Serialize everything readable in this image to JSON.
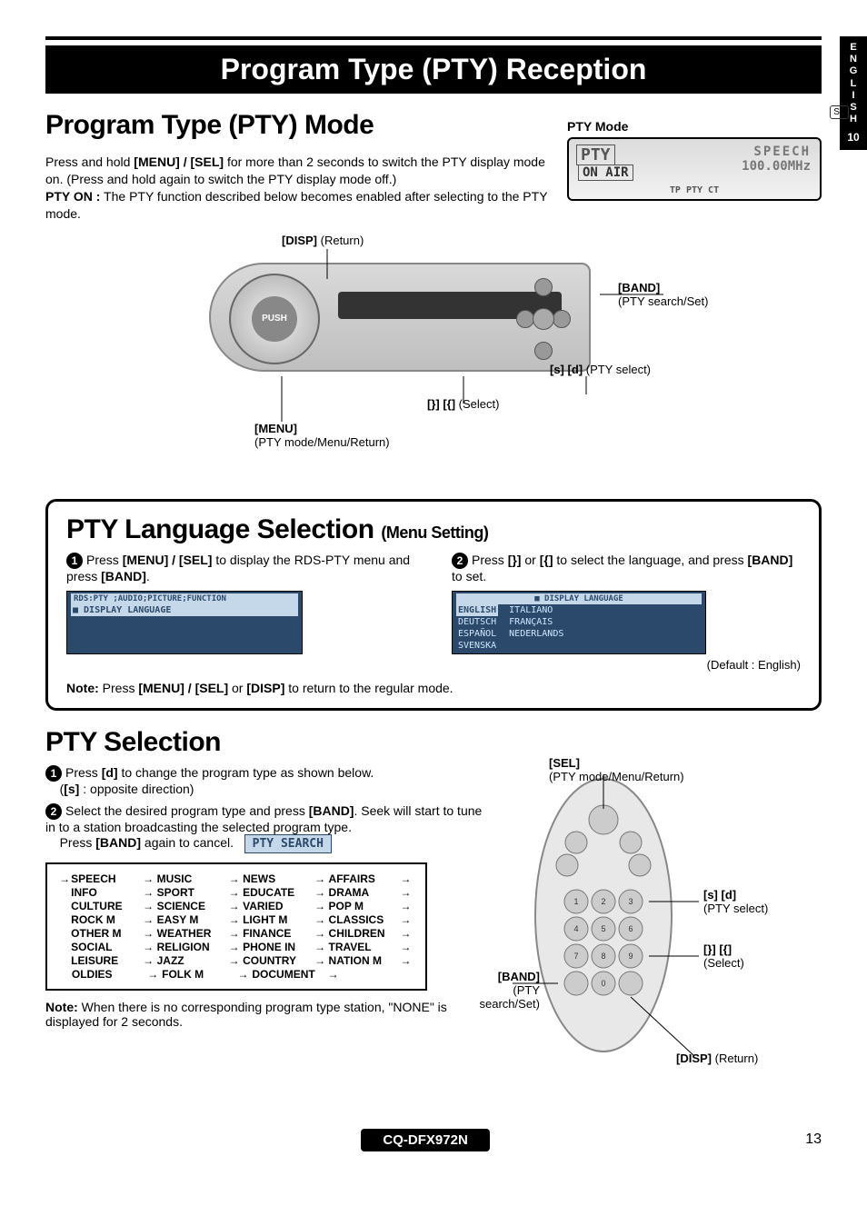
{
  "side_tab": {
    "language": "ENGLISH",
    "page_group": "10"
  },
  "title": "Program Type (PTY) Reception",
  "mode": {
    "heading": "Program Type (PTY) Mode",
    "intro1": "Press and hold ",
    "intro_key1": "[MENU] / [SEL]",
    "intro2": " for more than 2 seconds to switch the PTY display mode on. (Press and hold again to switch the PTY display mode off.)",
    "pty_on_label": "PTY ON :",
    "pty_on_text": " The PTY function described below becomes enabled after selecting to the PTY mode.",
    "panel": {
      "lcd_label": "PTY Mode",
      "lcd_pty": "PTY",
      "lcd_speech": "SPEECH",
      "lcd_freq": "100.00MHz",
      "lcd_onair": "ON AIR",
      "lcd_bottom": "TP  PTY  CT",
      "stereo": "ST"
    },
    "callouts": {
      "disp": "[DISP]",
      "disp_sub": "(Return)",
      "band": "[BAND]",
      "band_sub": "(PTY search/Set)",
      "lr": "[s] [d]",
      "lr_sub": "(PTY select)",
      "ud": "[}] [{]",
      "ud_sub": "(Select)",
      "menu": "[MENU]",
      "menu_sub": "(PTY mode/Menu/Return)",
      "push": "PUSH"
    }
  },
  "lang": {
    "heading": "PTY Language Selection",
    "heading_sub": "(Menu Setting)",
    "step1a": "Press ",
    "step1_key1": "[MENU] / [SEL]",
    "step1b": " to display the RDS-PTY menu and press ",
    "step1_key2": "[BAND]",
    "step1c": ".",
    "step2a": "Press ",
    "step2_key1": "[}]",
    "step2_or": " or ",
    "step2_key2": "[{]",
    "step2b": " to select the language, and press ",
    "step2_key3": "[BAND]",
    "step2c": " to set.",
    "menu1_header": "RDS:PTY ;AUDIO;PICTURE;FUNCTION",
    "menu1_item": "■ DISPLAY LANGUAGE",
    "menu2_header": "■ DISPLAY LANGUAGE",
    "menu2_left": [
      "ENGLISH",
      "DEUTSCH",
      "ESPAÑOL",
      "SVENSKA"
    ],
    "menu2_right": [
      "ITALIANO",
      "FRANÇAIS",
      "NEDERLANDS"
    ],
    "default": "(Default : English)",
    "note_label": "Note:",
    "note_text": " Press ",
    "note_key1": "[MENU] / [SEL]",
    "note_or": " or ",
    "note_key2": "[DISP]",
    "note_end": " to return to the regular mode."
  },
  "sel": {
    "heading": "PTY Selection",
    "step1a": "Press ",
    "step1_key": "[d]",
    "step1b": " to change the program type as shown below.",
    "step1_sub_open": "(",
    "step1_sub_key": "[s]",
    "step1_sub_text": " : opposite direction)",
    "step2a": "Select the desired program type and press ",
    "step2_key": "[BAND]",
    "step2b": ". Seek will start to tune in to a station broadcasting the selected program type.",
    "step2c": "Press ",
    "step2_key2": "[BAND]",
    "step2d": " again to cancel.",
    "search_chip": "PTY SEARCH",
    "table": [
      [
        "SPEECH",
        "MUSIC",
        "NEWS",
        "AFFAIRS"
      ],
      [
        "INFO",
        "SPORT",
        "EDUCATE",
        "DRAMA"
      ],
      [
        "CULTURE",
        "SCIENCE",
        "VARIED",
        "POP M"
      ],
      [
        "ROCK M",
        "EASY M",
        "LIGHT M",
        "CLASSICS"
      ],
      [
        "OTHER M",
        "WEATHER",
        "FINANCE",
        "CHILDREN"
      ],
      [
        "SOCIAL",
        "RELIGION",
        "PHONE IN",
        "TRAVEL"
      ],
      [
        "LEISURE",
        "JAZZ",
        "COUNTRY",
        "NATION M"
      ],
      [
        "OLDIES",
        "FOLK M",
        "DOCUMENT",
        ""
      ]
    ],
    "note_label": "Note:",
    "note_text": " When there is no corresponding program type station, \"NONE\" is displayed for 2 seconds.",
    "remote": {
      "sel": "[SEL]",
      "sel_sub": "(PTY mode/Menu/Return)",
      "lr": "[s] [d]",
      "lr_sub": "(PTY select)",
      "ud": "[}] [{]",
      "ud_sub": "(Select)",
      "band": "[BAND]",
      "band_sub": "(PTY search/Set)",
      "disp": "[DISP]",
      "disp_sub": "(Return)"
    }
  },
  "footer": {
    "model": "CQ-DFX972N",
    "page": "13"
  }
}
